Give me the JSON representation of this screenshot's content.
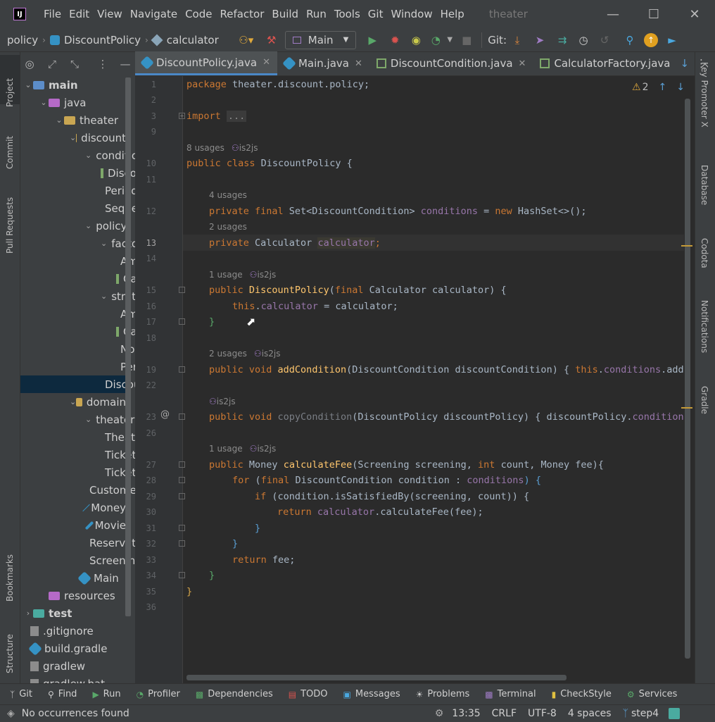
{
  "menu": {
    "items": [
      "File",
      "Edit",
      "View",
      "Navigate",
      "Code",
      "Refactor",
      "Build",
      "Run",
      "Tools",
      "Git",
      "Window",
      "Help"
    ],
    "project_title": "theater"
  },
  "nav": {
    "breadcrumb": [
      "policy",
      "DiscountPolicy",
      "calculator"
    ],
    "run_config": "Main",
    "git_label": "Git:"
  },
  "left_tools": [
    "Project",
    "Commit",
    "Pull Requests",
    "Bookmarks",
    "Structure"
  ],
  "right_tools": [
    "Key Promoter X",
    "Database",
    "Codota",
    "Notifications",
    "Gradle"
  ],
  "tabs": [
    {
      "label": "DiscountPolicy.java",
      "active": true
    },
    {
      "label": "Main.java",
      "active": false
    },
    {
      "label": "DiscountCondition.java",
      "active": false
    },
    {
      "label": "CalculatorFactory.java",
      "active": false
    }
  ],
  "tree": [
    {
      "label": "main",
      "indent": 0,
      "icon": "folder-blue",
      "chev": "v",
      "bold": true
    },
    {
      "label": "java",
      "indent": 1,
      "icon": "folder-purple",
      "chev": "v"
    },
    {
      "label": "theater",
      "indent": 2,
      "icon": "folder",
      "chev": "v"
    },
    {
      "label": "discount",
      "indent": 3,
      "icon": "folder",
      "chev": "v"
    },
    {
      "label": "condition",
      "indent": 4,
      "icon": "folder",
      "chev": "v"
    },
    {
      "label": "DiscountCondition",
      "indent": 5,
      "icon": "interface"
    },
    {
      "label": "PeriodCondition",
      "indent": 5,
      "icon": "class"
    },
    {
      "label": "SequenceCondition",
      "indent": 5,
      "icon": "class"
    },
    {
      "label": "policy",
      "indent": 4,
      "icon": "folder",
      "chev": "v"
    },
    {
      "label": "factory",
      "indent": 5,
      "icon": "folder",
      "chev": "v"
    },
    {
      "label": "AmountCalculatorFactory",
      "indent": 6,
      "icon": "class"
    },
    {
      "label": "CalculatorFactory",
      "indent": 6,
      "icon": "interface"
    },
    {
      "label": "strategy",
      "indent": 5,
      "icon": "folder-blue",
      "chev": "v"
    },
    {
      "label": "AmountCalculator",
      "indent": 6,
      "icon": "class"
    },
    {
      "label": "Calculator",
      "indent": 6,
      "icon": "interface"
    },
    {
      "label": "NoneCalculator",
      "indent": 6,
      "icon": "class"
    },
    {
      "label": "PercentCalculator",
      "indent": 6,
      "icon": "class"
    },
    {
      "label": "DiscountPolicy",
      "indent": 5,
      "icon": "class",
      "selected": true
    },
    {
      "label": "domain",
      "indent": 3,
      "icon": "folder",
      "chev": "v"
    },
    {
      "label": "theater",
      "indent": 4,
      "icon": "folder",
      "chev": "v"
    },
    {
      "label": "Theater",
      "indent": 5,
      "icon": "class"
    },
    {
      "label": "TicketOffice",
      "indent": 5,
      "icon": "class"
    },
    {
      "label": "TicketSeller",
      "indent": 5,
      "icon": "class"
    },
    {
      "label": "Customer",
      "indent": 4,
      "icon": "class"
    },
    {
      "label": "Money",
      "indent": 4,
      "icon": "class"
    },
    {
      "label": "Movie",
      "indent": 4,
      "icon": "class"
    },
    {
      "label": "Reservation",
      "indent": 4,
      "icon": "class"
    },
    {
      "label": "Screening",
      "indent": 4,
      "icon": "class"
    },
    {
      "label": "Main",
      "indent": 3,
      "icon": "class"
    },
    {
      "label": "resources",
      "indent": 1,
      "icon": "folder-purple"
    },
    {
      "label": "test",
      "indent": 0,
      "icon": "folder-teal",
      "chev": ">",
      "bold": true
    },
    {
      "label": ".gitignore",
      "indent": -1,
      "icon": "file"
    },
    {
      "label": "build.gradle",
      "indent": -1,
      "icon": "gradle"
    },
    {
      "label": "gradlew",
      "indent": -1,
      "icon": "file"
    },
    {
      "label": "gradlew.bat",
      "indent": -1,
      "icon": "file"
    }
  ],
  "editor": {
    "warnings": "2",
    "line_numbers": [
      "1",
      "2",
      "3",
      "9",
      "",
      "10",
      "11",
      "",
      "12",
      "",
      "13",
      "14",
      "",
      "15",
      "16",
      "17",
      "18",
      "",
      "19",
      "22",
      "",
      "23",
      "26",
      "",
      "27",
      "28",
      "29",
      "30",
      "31",
      "32",
      "33",
      "34",
      "35",
      "36"
    ],
    "hints": {
      "h1": "8 usages",
      "h1u": "is2js",
      "h2": "4 usages",
      "h3": "2 usages",
      "h4": "1 usage",
      "h4u": "is2js",
      "h5": "2 usages",
      "h5u": "is2js",
      "h6u": "is2js",
      "h7": "1 usage",
      "h7u": "is2js"
    },
    "code": {
      "c1a": "package ",
      "c1b": "theater.discount.policy;",
      "c3a": "import ",
      "c3b": "...",
      "c10a": "public class ",
      "c10b": "DiscountPolicy {",
      "c12a": "private final ",
      "c12b": "Set<DiscountCondition> ",
      "c12c": "conditions",
      "c12d": " = ",
      "c12e": "new ",
      "c12f": "HashSet<>();",
      "c13a": "private ",
      "c13b": "Calculator ",
      "c13c": "calculator",
      "c13d": ";",
      "c15a": "public ",
      "c15b": "DiscountPolicy",
      "c15c": "(",
      "c15d": "final ",
      "c15e": "Calculator calculator) {",
      "c16a": "this",
      "c16b": ".",
      "c16c": "calculator",
      "c16d": " = calculator;",
      "c17": "}",
      "c19a": "public void ",
      "c19b": "addCondition",
      "c19c": "(DiscountCondition discountCondition) { ",
      "c19d": "this",
      "c19e": ".",
      "c19f": "conditions",
      "c19g": ".add(di",
      "c23a": "public void ",
      "c23b": "copyCondition",
      "c23c": "(DiscountPolicy discountPolicy) { discountPolicy.",
      "c23d": "conditions",
      ".c23e": "",
      "c23e": ".a",
      "c27a": "public ",
      "c27b": "Money ",
      "c27c": "calculateFee",
      "c27d": "(Screening screening, ",
      "c27e": "int ",
      "c27f": "count, Money fee){",
      "c28a": "for ",
      "c28b": "(",
      "c28c": "final ",
      "c28d": "DiscountCondition condition : ",
      "c28e": "conditions",
      ") {": "",
      "c28f": ") {",
      "c29a": "if ",
      "c29b": "(condition.isSatisfiedBy(screening, count)) {",
      "c30a": "return ",
      "c30b": "calculator",
      "c30c": ".calculateFee(fee);",
      "c31": "}",
      "c32": "}",
      "c33a": "return ",
      "c33b": "fee;",
      "c34": "}",
      "c35": "}"
    }
  },
  "bottom_tools": [
    "Git",
    "Find",
    "Run",
    "Profiler",
    "Dependencies",
    "TODO",
    "Messages",
    "Problems",
    "Terminal",
    "CheckStyle",
    "Services"
  ],
  "status": {
    "message": "No occurrences found",
    "position": "13:35",
    "line_sep": "CRLF",
    "encoding": "UTF-8",
    "indent": "4 spaces",
    "branch": "step4"
  },
  "colors": {
    "keyword": "#cc7832",
    "field": "#9876aa",
    "function": "#ffc66d",
    "text": "#a9b7c6",
    "accent": "#4a88c7"
  }
}
